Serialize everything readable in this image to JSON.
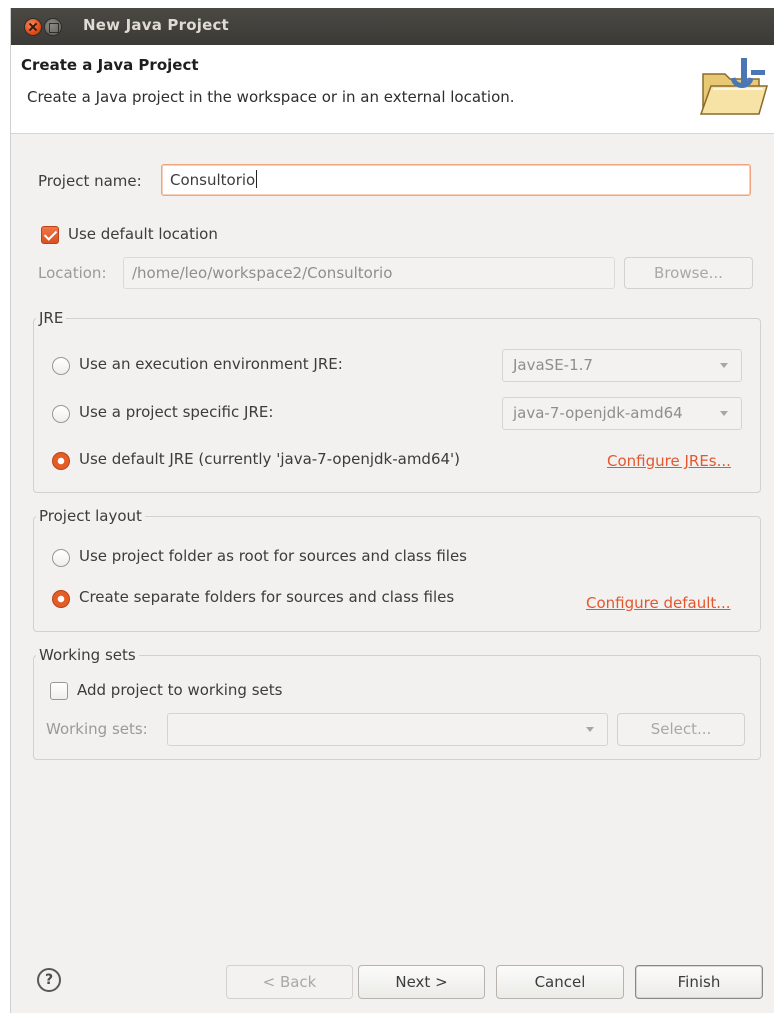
{
  "window": {
    "title": "New Java Project"
  },
  "header": {
    "title": "Create a Java Project",
    "description": "Create a Java project in the workspace or in an external location."
  },
  "project_name": {
    "label": "Project name:",
    "value": "Consultorio"
  },
  "location": {
    "use_default_label": "Use default location",
    "use_default_checked": true,
    "label": "Location:",
    "value": "/home/leo/workspace2/Consultorio",
    "browse_label": "Browse..."
  },
  "jre": {
    "group_title": "JRE",
    "options": [
      {
        "label": "Use an execution environment JRE:",
        "selected": false,
        "combo_value": "JavaSE-1.7"
      },
      {
        "label": "Use a project specific JRE:",
        "selected": false,
        "combo_value": "java-7-openjdk-amd64"
      },
      {
        "label": "Use default JRE (currently 'java-7-openjdk-amd64')",
        "selected": true
      }
    ],
    "configure_link": "Configure JREs..."
  },
  "project_layout": {
    "group_title": "Project layout",
    "options": [
      {
        "label": "Use project folder as root for sources and class files",
        "selected": false
      },
      {
        "label": "Create separate folders for sources and class files",
        "selected": true
      }
    ],
    "configure_link": "Configure default..."
  },
  "working_sets": {
    "group_title": "Working sets",
    "add_label": "Add project to working sets",
    "add_checked": false,
    "label": "Working sets:",
    "combo_value": "",
    "select_label": "Select..."
  },
  "footer": {
    "help_icon": "question-mark-icon",
    "help_glyph": "?",
    "back_label": "< Back",
    "next_label": "Next >",
    "cancel_label": "Cancel",
    "finish_label": "Finish"
  },
  "colors": {
    "accent": "#e4572e",
    "titlebar": "#3b3a36",
    "dialog_bg": "#f2f1f0"
  }
}
